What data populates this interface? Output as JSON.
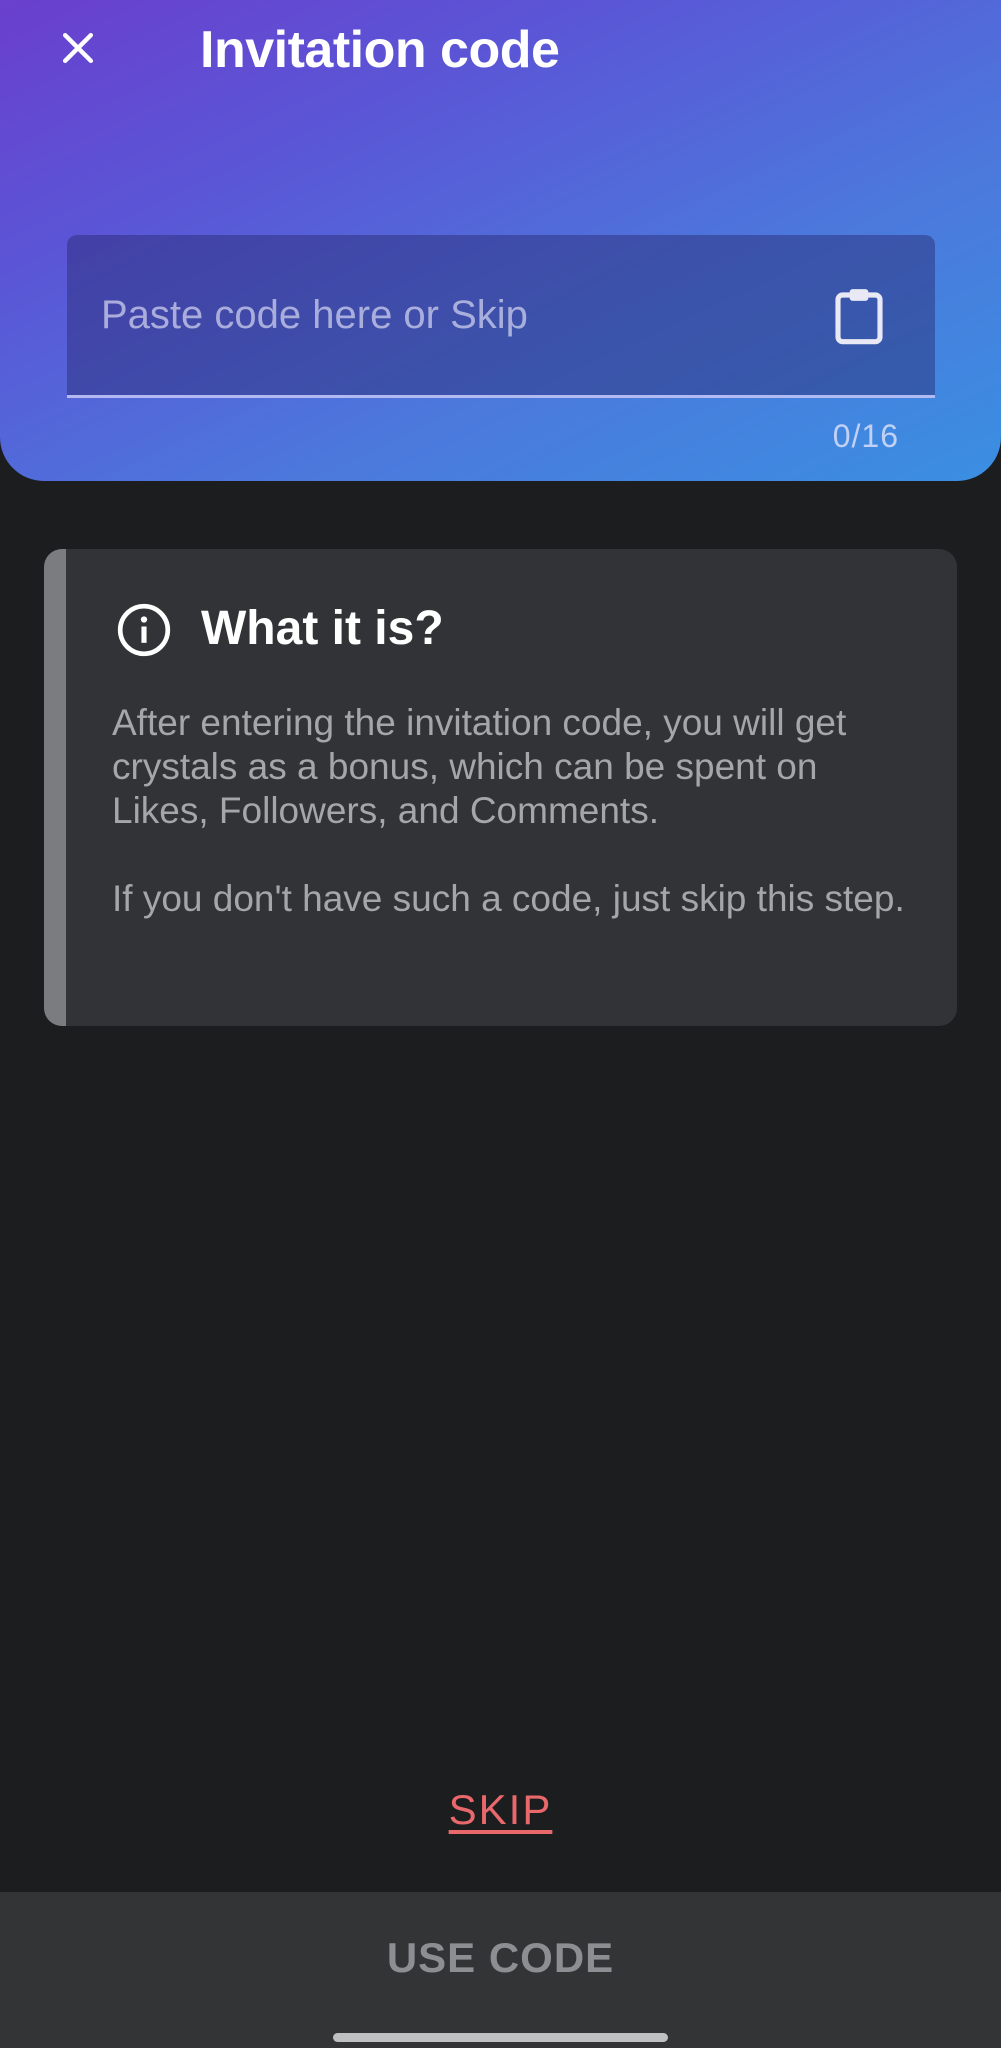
{
  "header": {
    "title": "Invitation code",
    "close_icon": "close-icon",
    "gradient_colors": [
      "#6a3fce",
      "#4c78dc",
      "#3a8fe2"
    ]
  },
  "code_field": {
    "value": "",
    "placeholder": "Paste code here or Skip",
    "paste_icon": "clipboard-icon",
    "counter": "0/16"
  },
  "info_card": {
    "icon": "info-icon",
    "title": "What it is?",
    "paragraph_1": "After entering the invitation code, you will get crystals as a bonus, which can be spent on Likes, Followers, and Comments.",
    "paragraph_2": "If you don't have such a code, just skip this step."
  },
  "actions": {
    "skip_label": "SKIP",
    "use_code_label": "USE CODE"
  },
  "colors": {
    "background": "#1c1d1f",
    "card": "#313336",
    "skip": "#e8686b",
    "button": "#333436"
  }
}
